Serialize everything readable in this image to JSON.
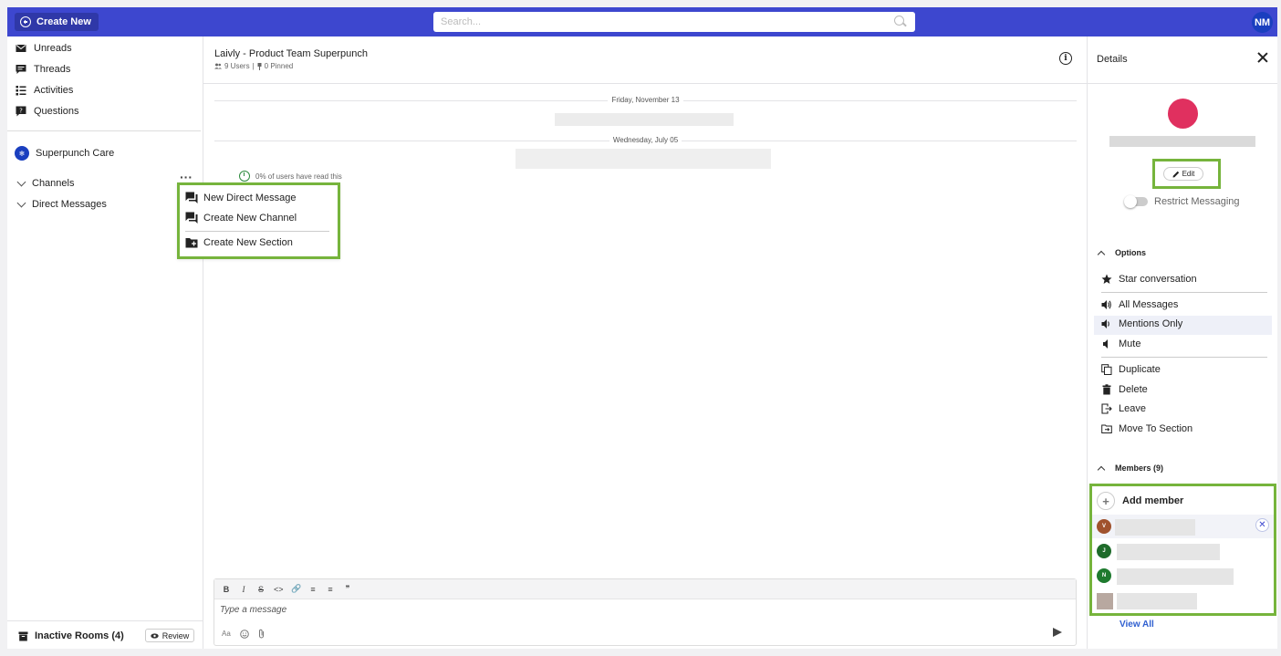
{
  "topbar": {
    "create_new_label": "Create New",
    "search_placeholder": "Search...",
    "user_initials": "NM"
  },
  "sidebar": {
    "nav": [
      {
        "label": "Unreads",
        "icon": "mail-icon"
      },
      {
        "label": "Threads",
        "icon": "threads-icon"
      },
      {
        "label": "Activities",
        "icon": "activities-icon"
      },
      {
        "label": "Questions",
        "icon": "question-icon"
      }
    ],
    "workspace": "Superpunch Care",
    "sections": [
      "Channels",
      "Direct Messages"
    ],
    "footer": {
      "inactive_rooms": "Inactive Rooms (4)",
      "review_label": "Review"
    }
  },
  "menu": {
    "items": [
      {
        "label": "New Direct Message",
        "icon": "chat-icon"
      },
      {
        "label": "Create New Channel",
        "icon": "chat-icon"
      },
      {
        "label": "Create New Section",
        "icon": "folder-plus-icon"
      }
    ]
  },
  "room": {
    "title": "Laivly - Product Team Superpunch",
    "users": "9 Users",
    "pinned": "0 Pinned",
    "date_1": "Friday, November 13",
    "date_2": "Wednesday, July 05",
    "read_status": "0% of users have read this"
  },
  "composer": {
    "placeholder": "Type a message",
    "tools": [
      "B",
      "I",
      "S",
      "<>",
      "🔗",
      "≡",
      "≡",
      "❞"
    ],
    "format_label": "Aa"
  },
  "details": {
    "title": "Details",
    "edit_label": "Edit",
    "restrict_label": "Restrict Messaging",
    "options_title": "Options",
    "options": [
      {
        "label": "Star conversation",
        "icon": "star-icon"
      },
      {
        "label": "All Messages",
        "icon": "volume-high-icon"
      },
      {
        "label": "Mentions Only",
        "icon": "volume-low-icon"
      },
      {
        "label": "Mute",
        "icon": "mute-icon"
      },
      {
        "label": "Duplicate",
        "icon": "copy-icon"
      },
      {
        "label": "Delete",
        "icon": "trash-icon"
      },
      {
        "label": "Leave",
        "icon": "leave-icon"
      },
      {
        "label": "Move To Section",
        "icon": "move-folder-icon"
      }
    ],
    "members_title": "Members (9)",
    "add_member": "Add member",
    "members": [
      {
        "initial": "V",
        "color": "#a0522d"
      },
      {
        "initial": "J",
        "color": "#1e6b2a"
      },
      {
        "initial": "N",
        "color": "#1e7a2e"
      },
      {
        "initial": "",
        "color": "#b8a8a0"
      }
    ],
    "view_all": "View All"
  },
  "colors": {
    "accent": "#3d47cf",
    "highlight_frame": "#76b43c"
  }
}
